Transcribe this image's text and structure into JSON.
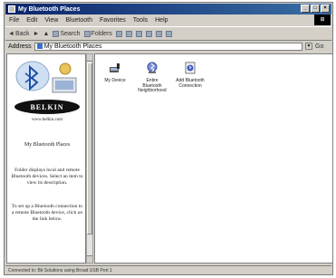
{
  "window": {
    "title": "My Bluetooth Places"
  },
  "menubar": {
    "items": [
      "File",
      "Edit",
      "View",
      "Bluetooth",
      "Favorites",
      "Tools",
      "Help"
    ]
  },
  "toolbar": {
    "back": "Back",
    "search": "Search",
    "folders": "Folders"
  },
  "address": {
    "label": "Address",
    "value": "My Bluetooth Places",
    "go": "Go"
  },
  "left_pane": {
    "url": "www.belkin.com",
    "brand": "BELKIN",
    "title": "My Bluetooth Places",
    "desc": "Folder displays local and remote Bluetooth devices. Select an item to view its description.",
    "desc2": "To set up a Bluetooth connection to a remote Bluetooth device, click on the link below."
  },
  "items": [
    {
      "label": "My Device",
      "icon": "device-icon"
    },
    {
      "label": "Entire Bluetooth Neighborhood",
      "icon": "bluetooth-neighborhood-icon"
    },
    {
      "label": "Add Bluetooth Connection",
      "icon": "add-connection-icon"
    }
  ],
  "status": {
    "text": "Connected to: Bit Solutions using Broad USB Port 1"
  }
}
